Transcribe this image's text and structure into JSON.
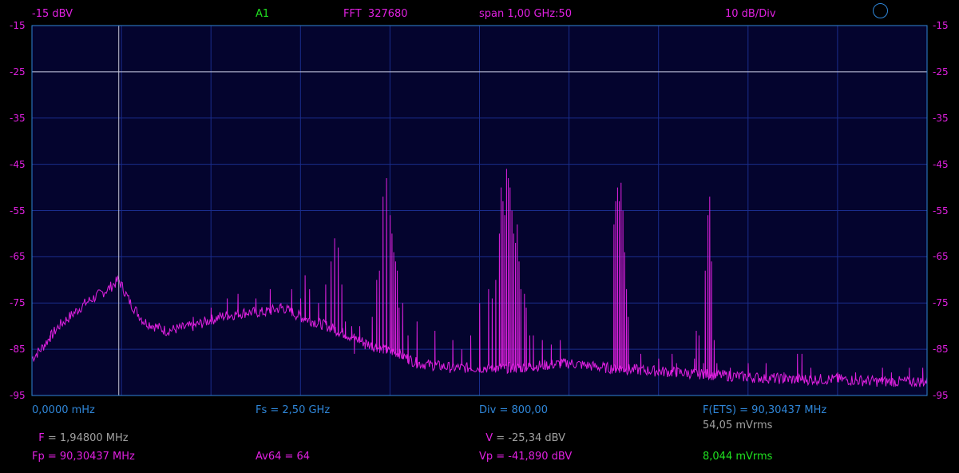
{
  "header": {
    "ref_level": "-15 dBV",
    "channel": "A1",
    "fft": "FFT  327680",
    "span": "span 1,00 GHz:50",
    "scale": "10 dB/Div"
  },
  "footer": {
    "row1": {
      "start_freq": "0,0000 mHz",
      "fs": "Fs = 2,50 GHz",
      "div": "Div = 800,00",
      "fets": "F(ETS) = 90,30437 MHz"
    },
    "row2": {
      "f_key": "F",
      "f_val": " = 1,94800 MHz",
      "v_key": "V",
      "v_val": " = -25,34 dBV",
      "vrms": "54,05 mVrms"
    },
    "row3": {
      "fp": "Fp = 90,30437 MHz",
      "av": "Av64 = 64",
      "vp": "Vp = -41,890 dBV",
      "mvrms": "8,044 mVrms"
    }
  },
  "colors": {
    "background": "#000000",
    "plot_bg": "#04042e",
    "grid": "#1a2d8c",
    "frame": "#2f86d8",
    "trace": "#e020e0",
    "cursor": "#c8c8d8",
    "magenta_text": "#e020e0",
    "green_text": "#20e020",
    "blue_text": "#2f86d8",
    "gray_text": "#a0a0a0"
  },
  "icons": {
    "status": "circle-icon"
  },
  "chart_data": {
    "type": "line",
    "title": "",
    "xlabel": "",
    "ylabel": "",
    "xlim": [
      0,
      1000
    ],
    "ylim": [
      -95,
      -15
    ],
    "y_ticks": [
      "-15",
      "-25",
      "-35",
      "-45",
      "-55",
      "-65",
      "-75",
      "-85",
      "-95"
    ],
    "y_tick_values": [
      -15,
      -25,
      -35,
      -45,
      -55,
      -65,
      -75,
      -85,
      -95
    ],
    "grid": true,
    "cursor": {
      "x": 97,
      "y": -25
    },
    "series": [
      {
        "baseline": [
          [
            0,
            -87
          ],
          [
            10,
            -85
          ],
          [
            30,
            -80
          ],
          [
            60,
            -75
          ],
          [
            85,
            -72
          ],
          [
            97,
            -70
          ],
          [
            110,
            -75
          ],
          [
            125,
            -79
          ],
          [
            150,
            -81
          ],
          [
            180,
            -80
          ],
          [
            210,
            -78
          ],
          [
            240,
            -77
          ],
          [
            260,
            -77
          ],
          [
            280,
            -76
          ],
          [
            300,
            -78
          ],
          [
            330,
            -80
          ],
          [
            365,
            -83
          ],
          [
            390,
            -85
          ],
          [
            410,
            -86
          ],
          [
            420,
            -87
          ],
          [
            430,
            -88
          ],
          [
            470,
            -89
          ],
          [
            520,
            -89
          ],
          [
            550,
            -89
          ],
          [
            570,
            -88.5
          ],
          [
            600,
            -88
          ],
          [
            620,
            -88.5
          ],
          [
            640,
            -89
          ],
          [
            680,
            -89.5
          ],
          [
            720,
            -90
          ],
          [
            760,
            -90.5
          ],
          [
            800,
            -91
          ],
          [
            850,
            -91.5
          ],
          [
            900,
            -91.5
          ],
          [
            950,
            -92
          ],
          [
            1000,
            -92
          ]
        ],
        "peaks": [
          [
            20,
            -82
          ],
          [
            180,
            -78
          ],
          [
            200,
            -76
          ],
          [
            218,
            -74
          ],
          [
            230,
            -73
          ],
          [
            250,
            -74
          ],
          [
            266,
            -72
          ],
          [
            278,
            -75
          ],
          [
            290,
            -72
          ],
          [
            300,
            -74
          ],
          [
            305,
            -69
          ],
          [
            310,
            -72
          ],
          [
            320,
            -75
          ],
          [
            328,
            -71
          ],
          [
            334,
            -66
          ],
          [
            338,
            -61
          ],
          [
            342,
            -63
          ],
          [
            346,
            -71
          ],
          [
            350,
            -79
          ],
          [
            357,
            -80
          ],
          [
            366,
            -80
          ],
          [
            350,
            -86
          ],
          [
            360,
            -86
          ],
          [
            372,
            -85
          ],
          [
            380,
            -78
          ],
          [
            385,
            -70
          ],
          [
            388,
            -68
          ],
          [
            392,
            -52
          ],
          [
            396,
            -48
          ],
          [
            400,
            -56
          ],
          [
            402,
            -60
          ],
          [
            404,
            -64
          ],
          [
            406,
            -66
          ],
          [
            408,
            -68
          ],
          [
            410,
            -76
          ],
          [
            414,
            -75
          ],
          [
            420,
            -82
          ],
          [
            430,
            -79
          ],
          [
            450,
            -81
          ],
          [
            470,
            -83
          ],
          [
            480,
            -85
          ],
          [
            490,
            -82
          ],
          [
            500,
            -75
          ],
          [
            510,
            -72
          ],
          [
            514,
            -74
          ],
          [
            518,
            -70
          ],
          [
            522,
            -60
          ],
          [
            524,
            -50
          ],
          [
            526,
            -53
          ],
          [
            528,
            -56
          ],
          [
            530,
            -46
          ],
          [
            532,
            -48
          ],
          [
            534,
            -50
          ],
          [
            536,
            -55
          ],
          [
            538,
            -60
          ],
          [
            540,
            -62
          ],
          [
            542,
            -58
          ],
          [
            544,
            -66
          ],
          [
            546,
            -72
          ],
          [
            550,
            -73
          ],
          [
            552,
            -76
          ],
          [
            556,
            -82
          ],
          [
            560,
            -82
          ],
          [
            570,
            -83
          ],
          [
            580,
            -84
          ],
          [
            590,
            -83
          ],
          [
            650,
            -58
          ],
          [
            652,
            -53
          ],
          [
            654,
            -50
          ],
          [
            656,
            -53
          ],
          [
            658,
            -49
          ],
          [
            660,
            -55
          ],
          [
            662,
            -64
          ],
          [
            664,
            -72
          ],
          [
            666,
            -78
          ],
          [
            680,
            -86
          ],
          [
            700,
            -87
          ],
          [
            715,
            -86
          ],
          [
            720,
            -88
          ],
          [
            740,
            -87
          ],
          [
            742,
            -81
          ],
          [
            745,
            -82
          ],
          [
            750,
            -88
          ],
          [
            752,
            -68
          ],
          [
            755,
            -56
          ],
          [
            757,
            -52
          ],
          [
            759,
            -66
          ],
          [
            762,
            -83
          ],
          [
            765,
            -88
          ],
          [
            780,
            -89
          ],
          [
            800,
            -88
          ],
          [
            820,
            -88
          ],
          [
            840,
            -90
          ],
          [
            855,
            -86
          ],
          [
            860,
            -86
          ],
          [
            870,
            -89
          ],
          [
            900,
            -90
          ],
          [
            920,
            -90
          ],
          [
            950,
            -89
          ],
          [
            960,
            -90
          ],
          [
            980,
            -89
          ],
          [
            995,
            -89
          ]
        ]
      }
    ]
  }
}
